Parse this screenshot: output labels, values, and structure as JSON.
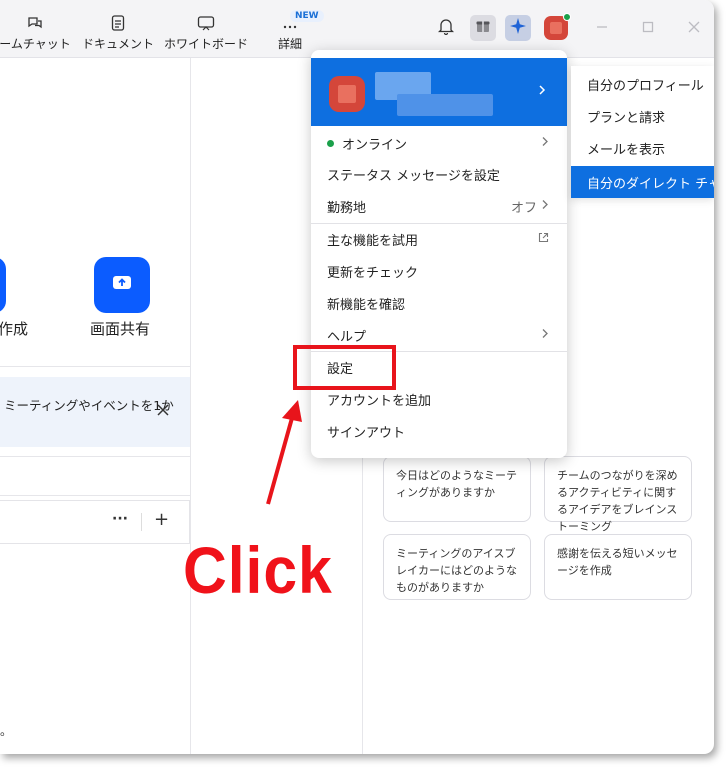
{
  "toolbar": {
    "items": [
      {
        "label": "ームチャット",
        "icon": "chat-bubble-icon"
      },
      {
        "label": "ドキュメント",
        "icon": "document-icon"
      },
      {
        "label": "ホワイトボード",
        "icon": "whiteboard-icon"
      },
      {
        "label": "詳細",
        "icon": "more-dots-icon"
      }
    ],
    "new_badge": "NEW"
  },
  "main": {
    "actions": [
      {
        "label": "作成"
      },
      {
        "label": "画面共有",
        "icon": "share-screen-icon"
      }
    ],
    "notice_text": "ミーティングやイベントを1か",
    "row_more": "···",
    "row_add": "+",
    "footnote": "。"
  },
  "menu": {
    "items": [
      {
        "label": "オンライン",
        "status": "online"
      },
      {
        "label": "ステータス メッセージを設定"
      },
      {
        "label": "勤務地",
        "value": "オフ"
      },
      {
        "label": "主な機能を試用"
      },
      {
        "label": "更新をチェック"
      },
      {
        "label": "新機能を確認"
      },
      {
        "label": "ヘルプ"
      },
      {
        "label": "設定"
      },
      {
        "label": "アカウントを追加"
      },
      {
        "label": "サインアウト"
      }
    ]
  },
  "submenu": {
    "items": [
      {
        "label": "自分のプロフィール"
      },
      {
        "label": "プランと請求"
      },
      {
        "label": "メールを表示"
      },
      {
        "label": "自分のダイレクト チャット"
      }
    ]
  },
  "suggestions": [
    {
      "text": "今日はどのようなミーティングがありますか"
    },
    {
      "text": "チームのつながりを深めるアクティビティに関するアイデアをブレインストーミング"
    },
    {
      "text": "ミーティングのアイスブレイカーにはどのようなものがありますか"
    },
    {
      "text": "感謝を伝える短いメッセージを作成"
    }
  ],
  "annotation": {
    "click_text": "Click"
  },
  "colors": {
    "accent": "#0e6fe0",
    "highlight": "#e8141b",
    "online": "#1aa04a"
  }
}
